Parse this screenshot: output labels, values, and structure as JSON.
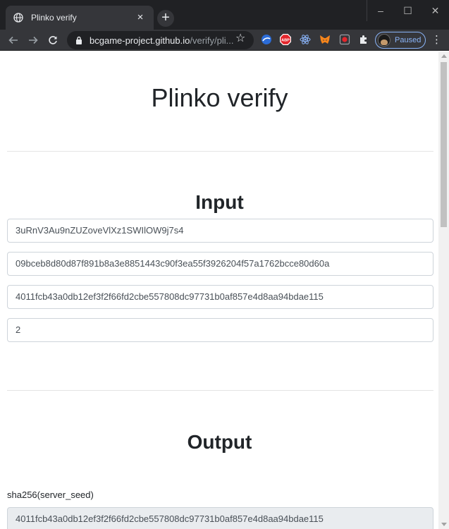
{
  "browser": {
    "tab_title": "Plinko verify",
    "tab_close": "×",
    "new_tab": "+",
    "window_controls": {
      "minimize": "–",
      "maximize": "☐",
      "close": "✕"
    },
    "url_host": "bcgame-project.github.io",
    "url_path": "/verify/pli...",
    "profile_status": "Paused",
    "extensions": [
      "extension-cloud-icon",
      "adblock-icon",
      "react-devtools-icon",
      "metamask-icon",
      "record-icon",
      "puzzle-icon"
    ],
    "adblock_label": "ABP"
  },
  "page": {
    "title": "Plinko verify",
    "input_heading": "Input",
    "inputs": [
      {
        "value": "3uRnV3Au9nZUZoveVlXz1SWIlOW9j7s4"
      },
      {
        "value": "09bceb8d80d87f891b8a3e8851443c90f3ea55f3926204f57a1762bcce80d60a"
      },
      {
        "value": "4011fcb43a0db12ef3f2f66fd2cbe557808dc97731b0af857e4d8aa94bdae115"
      },
      {
        "value": "2"
      }
    ],
    "output_heading": "Output",
    "output_label": "sha256(server_seed)",
    "output_value": "4011fcb43a0db12ef3f2f66fd2cbe557808dc97731b0af857e4d8aa94bdae115"
  },
  "colors": {
    "chrome_dark": "#202124",
    "chrome_tab": "#35363a",
    "profile_accent": "#8ab4f8",
    "input_border": "#ced4da",
    "readonly_bg": "#e9ecef"
  }
}
